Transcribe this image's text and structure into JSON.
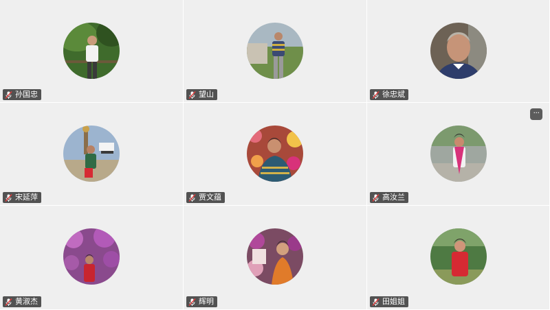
{
  "participants": [
    {
      "name": "孙国忠",
      "avatar": "man-white-shirt-forest-photo",
      "bg": "#3f6b2c",
      "fg": "#f2f2f2"
    },
    {
      "name": "望山",
      "avatar": "man-striped-shirt-park-photo",
      "bg": "#a9b8c2",
      "fg": "#3b4a73"
    },
    {
      "name": "徐忠斌",
      "avatar": "man-portrait-closeup-photo",
      "bg": "#6d6255",
      "fg": "#2e3d6b"
    },
    {
      "name": "宋延萍",
      "avatar": "woman-green-jacket-tower-photo",
      "bg": "#9cb4cf",
      "fg": "#2f6b45"
    },
    {
      "name": "贾文蕴",
      "avatar": "woman-flowers-background-photo",
      "bg": "#a8493a",
      "fg": "#2c5b73"
    },
    {
      "name": "高汝兰",
      "avatar": "woman-pink-scarf-road-photo",
      "bg": "#9fa7a0",
      "fg": "#d8327a"
    },
    {
      "name": "黄淑杰",
      "avatar": "woman-purple-blossoms-photo",
      "bg": "#8a4a8d",
      "fg": "#c8252f"
    },
    {
      "name": "辉明",
      "avatar": "woman-orange-dress-flowers-photo",
      "bg": "#7b4b63",
      "fg": "#e07b2a"
    },
    {
      "name": "田姐姐",
      "avatar": "woman-red-jacket-garden-photo",
      "bg": "#4e7a43",
      "fg": "#d62a33"
    }
  ],
  "more_button": {
    "label": "···",
    "icon": "more-dots-icon"
  },
  "label_icon": "muted-microphone-icon"
}
